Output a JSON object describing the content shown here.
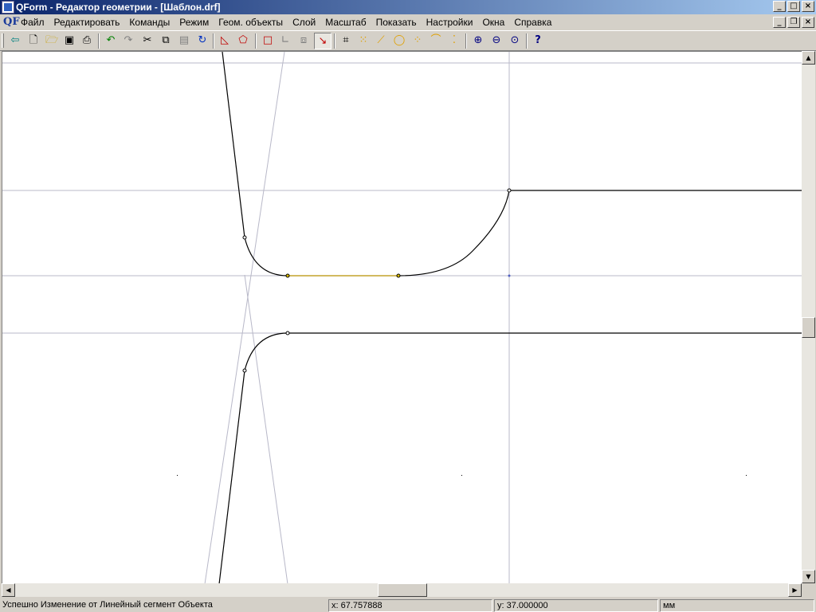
{
  "window": {
    "title": "QForm - Редактор геометрии - [Шаблон.drf]",
    "app_icon": "qform-app-icon",
    "controls": [
      "minimize-icon",
      "maximize-icon",
      "close-icon"
    ]
  },
  "menubar": {
    "logo": "QF",
    "items": [
      "Файл",
      "Редактировать",
      "Команды",
      "Режим",
      "Геом. объекты",
      "Слой",
      "Масштаб",
      "Показать",
      "Настройки",
      "Окна",
      "Справка"
    ]
  },
  "toolbar": {
    "icons": [
      "exit-icon",
      "new-file-icon",
      "open-folder-icon",
      "save-icon",
      "print-icon",
      "undo-icon",
      "redo-icon",
      "cut-icon",
      "copy-icon",
      "paste-icon",
      "refresh-icon",
      "draw-outline-icon",
      "draw-outline-alt-icon",
      "rectangle-icon",
      "angle-icon",
      "transform-icon",
      "select-cursor-icon",
      "trim-icon",
      "point-grid-icon",
      "line-icon",
      "circle-icon",
      "arc-points-icon",
      "arc-icon",
      "point-set-icon",
      "zoom-in-icon",
      "zoom-out-icon",
      "zoom-fit-icon",
      "help-icon"
    ]
  },
  "statusbar": {
    "message": "Успешно Изменение от Линейный сегмент Объекта",
    "x": "x: 67.757888",
    "y": "y: 37.000000",
    "units": "мм"
  }
}
